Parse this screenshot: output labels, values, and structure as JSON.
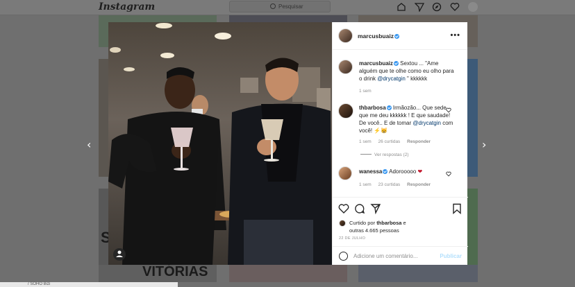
{
  "app": {
    "logo": "Instagram"
  },
  "search": {
    "placeholder": "Pesquisar"
  },
  "nav_icons": [
    "home-icon",
    "direct-icon",
    "explore-icon",
    "heart-icon",
    "profile-avatar"
  ],
  "background": {
    "tile_text_1": "S",
    "tile_text_2": "VITÓRIAS"
  },
  "post": {
    "author": "marcusbuaiz",
    "more_label": "•••",
    "caption": {
      "username": "marcusbuaiz",
      "text": " Sextou ... \"Ame alguém que te olhe como eu olho para o drink ",
      "mention": "@drycatgin",
      "text_end": " \" kkkkkk",
      "time": "1 sem"
    },
    "comments": [
      {
        "username": "thbarbosa",
        "text": " Irmãozão... Que sede que me deu kkkkkk ! E que saudade! De você.. E de tomar ",
        "mention": "@drycatgin",
        "text_end": " com você! ⚡😸",
        "time": "1 sem",
        "likes": "26 curtidas",
        "reply": "Responder",
        "view_replies": "Ver respostas (2)"
      },
      {
        "username": "wanessa",
        "text": " Adorooooo ",
        "heart": "❤",
        "time": "1 sem",
        "likes": "23 curtidas",
        "reply": "Responder"
      }
    ],
    "liked_by": {
      "prefix": "Curtido por ",
      "user": "thbarbosa",
      "middle": " e",
      "others": "outras 4.665 pessoas"
    },
    "date": "22 DE JULHO",
    "comment_placeholder": "Adicione um comentário...",
    "publish_label": "Publicar"
  },
  "navigation": {
    "prev": "‹",
    "next": "›"
  },
  "bottom_bar": {
    "text": "/ SOHO Bizi"
  },
  "colors": {
    "verified": "#3897f0",
    "mention": "#00376b",
    "publish_disabled": "#b2dffc"
  }
}
